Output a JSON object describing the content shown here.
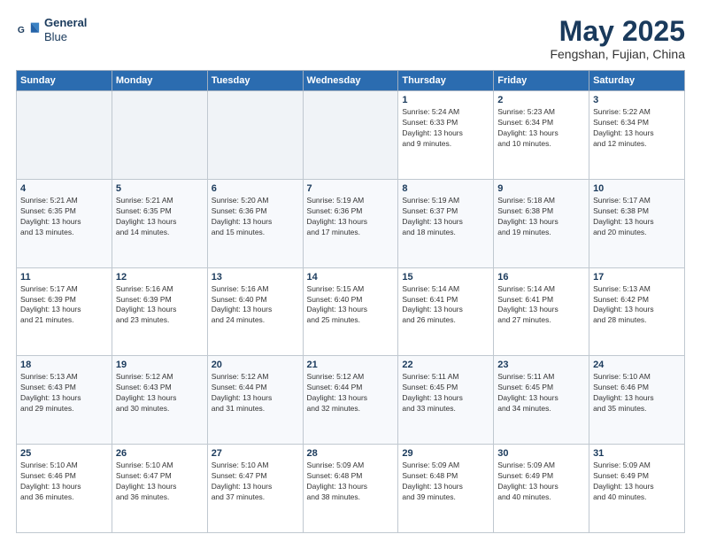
{
  "header": {
    "logo_line1": "General",
    "logo_line2": "Blue",
    "title": "May 2025",
    "subtitle": "Fengshan, Fujian, China"
  },
  "weekdays": [
    "Sunday",
    "Monday",
    "Tuesday",
    "Wednesday",
    "Thursday",
    "Friday",
    "Saturday"
  ],
  "weeks": [
    [
      {
        "day": "",
        "info": ""
      },
      {
        "day": "",
        "info": ""
      },
      {
        "day": "",
        "info": ""
      },
      {
        "day": "",
        "info": ""
      },
      {
        "day": "1",
        "info": "Sunrise: 5:24 AM\nSunset: 6:33 PM\nDaylight: 13 hours\nand 9 minutes."
      },
      {
        "day": "2",
        "info": "Sunrise: 5:23 AM\nSunset: 6:34 PM\nDaylight: 13 hours\nand 10 minutes."
      },
      {
        "day": "3",
        "info": "Sunrise: 5:22 AM\nSunset: 6:34 PM\nDaylight: 13 hours\nand 12 minutes."
      }
    ],
    [
      {
        "day": "4",
        "info": "Sunrise: 5:21 AM\nSunset: 6:35 PM\nDaylight: 13 hours\nand 13 minutes."
      },
      {
        "day": "5",
        "info": "Sunrise: 5:21 AM\nSunset: 6:35 PM\nDaylight: 13 hours\nand 14 minutes."
      },
      {
        "day": "6",
        "info": "Sunrise: 5:20 AM\nSunset: 6:36 PM\nDaylight: 13 hours\nand 15 minutes."
      },
      {
        "day": "7",
        "info": "Sunrise: 5:19 AM\nSunset: 6:36 PM\nDaylight: 13 hours\nand 17 minutes."
      },
      {
        "day": "8",
        "info": "Sunrise: 5:19 AM\nSunset: 6:37 PM\nDaylight: 13 hours\nand 18 minutes."
      },
      {
        "day": "9",
        "info": "Sunrise: 5:18 AM\nSunset: 6:38 PM\nDaylight: 13 hours\nand 19 minutes."
      },
      {
        "day": "10",
        "info": "Sunrise: 5:17 AM\nSunset: 6:38 PM\nDaylight: 13 hours\nand 20 minutes."
      }
    ],
    [
      {
        "day": "11",
        "info": "Sunrise: 5:17 AM\nSunset: 6:39 PM\nDaylight: 13 hours\nand 21 minutes."
      },
      {
        "day": "12",
        "info": "Sunrise: 5:16 AM\nSunset: 6:39 PM\nDaylight: 13 hours\nand 23 minutes."
      },
      {
        "day": "13",
        "info": "Sunrise: 5:16 AM\nSunset: 6:40 PM\nDaylight: 13 hours\nand 24 minutes."
      },
      {
        "day": "14",
        "info": "Sunrise: 5:15 AM\nSunset: 6:40 PM\nDaylight: 13 hours\nand 25 minutes."
      },
      {
        "day": "15",
        "info": "Sunrise: 5:14 AM\nSunset: 6:41 PM\nDaylight: 13 hours\nand 26 minutes."
      },
      {
        "day": "16",
        "info": "Sunrise: 5:14 AM\nSunset: 6:41 PM\nDaylight: 13 hours\nand 27 minutes."
      },
      {
        "day": "17",
        "info": "Sunrise: 5:13 AM\nSunset: 6:42 PM\nDaylight: 13 hours\nand 28 minutes."
      }
    ],
    [
      {
        "day": "18",
        "info": "Sunrise: 5:13 AM\nSunset: 6:43 PM\nDaylight: 13 hours\nand 29 minutes."
      },
      {
        "day": "19",
        "info": "Sunrise: 5:12 AM\nSunset: 6:43 PM\nDaylight: 13 hours\nand 30 minutes."
      },
      {
        "day": "20",
        "info": "Sunrise: 5:12 AM\nSunset: 6:44 PM\nDaylight: 13 hours\nand 31 minutes."
      },
      {
        "day": "21",
        "info": "Sunrise: 5:12 AM\nSunset: 6:44 PM\nDaylight: 13 hours\nand 32 minutes."
      },
      {
        "day": "22",
        "info": "Sunrise: 5:11 AM\nSunset: 6:45 PM\nDaylight: 13 hours\nand 33 minutes."
      },
      {
        "day": "23",
        "info": "Sunrise: 5:11 AM\nSunset: 6:45 PM\nDaylight: 13 hours\nand 34 minutes."
      },
      {
        "day": "24",
        "info": "Sunrise: 5:10 AM\nSunset: 6:46 PM\nDaylight: 13 hours\nand 35 minutes."
      }
    ],
    [
      {
        "day": "25",
        "info": "Sunrise: 5:10 AM\nSunset: 6:46 PM\nDaylight: 13 hours\nand 36 minutes."
      },
      {
        "day": "26",
        "info": "Sunrise: 5:10 AM\nSunset: 6:47 PM\nDaylight: 13 hours\nand 36 minutes."
      },
      {
        "day": "27",
        "info": "Sunrise: 5:10 AM\nSunset: 6:47 PM\nDaylight: 13 hours\nand 37 minutes."
      },
      {
        "day": "28",
        "info": "Sunrise: 5:09 AM\nSunset: 6:48 PM\nDaylight: 13 hours\nand 38 minutes."
      },
      {
        "day": "29",
        "info": "Sunrise: 5:09 AM\nSunset: 6:48 PM\nDaylight: 13 hours\nand 39 minutes."
      },
      {
        "day": "30",
        "info": "Sunrise: 5:09 AM\nSunset: 6:49 PM\nDaylight: 13 hours\nand 40 minutes."
      },
      {
        "day": "31",
        "info": "Sunrise: 5:09 AM\nSunset: 6:49 PM\nDaylight: 13 hours\nand 40 minutes."
      }
    ]
  ]
}
